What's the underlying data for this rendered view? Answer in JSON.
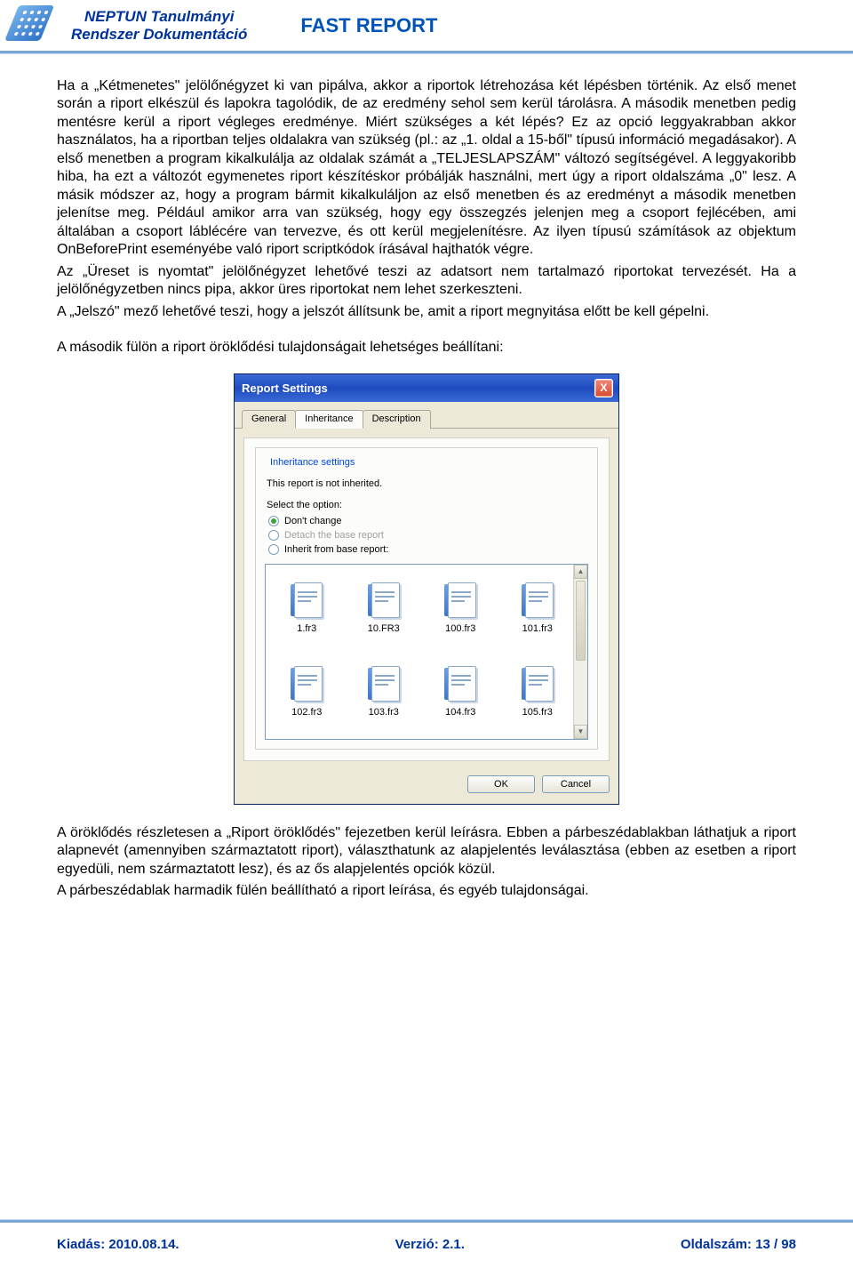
{
  "header": {
    "title_line1": "NEPTUN Tanulmányi",
    "title_line2": "Rendszer Dokumentáció",
    "fast_report": "FAST REPORT"
  },
  "body": {
    "p1": "Ha a „Kétmenetes\" jelölőnégyzet ki van pipálva, akkor a riportok létrehozása két lépésben történik. Az első menet során a riport elkészül és lapokra tagolódik, de az eredmény sehol sem kerül tárolásra. A második menetben pedig mentésre kerül a riport végleges eredménye. Miért szükséges a két lépés? Ez az opció leggyakrabban akkor használatos, ha a riportban teljes oldalakra van szükség (pl.: az „1. oldal a 15-ből\" típusú információ megadásakor). A első menetben a program kikalkulálja az oldalak számát a „TELJESLAPSZÁM\" változó segítségével. A leggyakoribb hiba, ha ezt a változót egymenetes riport készítéskor próbálják használni, mert úgy a riport oldalszáma „0\" lesz. A másik módszer az, hogy a program bármit kikalkuláljon az első menetben és az eredményt a második menetben jelenítse meg. Például amikor arra van szükség, hogy egy összegzés jelenjen meg a csoport fejlécében, ami általában a csoport láblécére van tervezve, és ott kerül megjelenítésre. Az ilyen típusú számítások az objektum OnBeforePrint eseményébe való riport scriptkódok írásával hajthatók végre.",
    "p2": "Az „Üreset is nyomtat\" jelölőnégyzet lehetővé teszi az adatsort nem tartalmazó riportokat tervezését. Ha a jelölőnégyzetben nincs pipa, akkor üres riportokat nem lehet szerkeszteni.",
    "p3": "A „Jelszó\" mező lehetővé teszi, hogy a jelszót állítsunk be, amit a riport megnyitása előtt be kell gépelni.",
    "p4": "A második fülön a riport öröklődési tulajdonságait lehetséges beállítani:",
    "p5": "A öröklődés részletesen a „Riport öröklődés\" fejezetben kerül leírásra. Ebben a párbeszédablakban láthatjuk a riport alapnevét (amennyiben származtatott riport), választhatunk az alapjelentés leválasztása (ebben az esetben a riport egyedüli, nem származtatott lesz), és az ős alapjelentés opciók közül.",
    "p6": "A párbeszédablak harmadik fülén beállítható a riport leírása, és egyéb tulajdonságai."
  },
  "dialog": {
    "title": "Report Settings",
    "close": "X",
    "tabs": [
      "General",
      "Inheritance",
      "Description"
    ],
    "active_tab": 1,
    "group_label": "Inheritance settings",
    "info": "This report is not inherited.",
    "select_text": "Select the option:",
    "options": [
      {
        "label": "Don't change",
        "checked": true,
        "disabled": false
      },
      {
        "label": "Detach the base report",
        "checked": false,
        "disabled": true
      },
      {
        "label": "Inherit from base report:",
        "checked": false,
        "disabled": false
      }
    ],
    "files": [
      "1.fr3",
      "10.FR3",
      "100.fr3",
      "101.fr3",
      "102.fr3",
      "103.fr3",
      "104.fr3",
      "105.fr3"
    ],
    "buttons": {
      "ok": "OK",
      "cancel": "Cancel"
    },
    "scroll": {
      "up": "▲",
      "down": "▼"
    }
  },
  "footer": {
    "left": "Kiadás: 2010.08.14.",
    "center": "Verzió: 2.1.",
    "right": "Oldalszám: 13 / 98"
  }
}
